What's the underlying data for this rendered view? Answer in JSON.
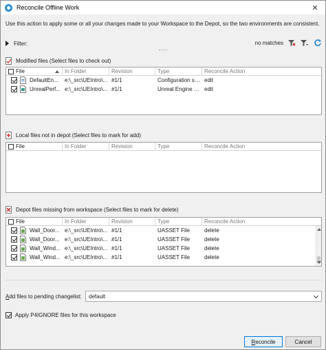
{
  "window": {
    "title": "Reconcile Offline Work",
    "close_glyph": "✕"
  },
  "intro_text": "Use this action to apply some or all your changes made to your Workspace to the Depot, so the two environments are consistent.",
  "filter": {
    "label": "Filter:",
    "status": "no matches"
  },
  "columns": {
    "file": "File",
    "folder": "In Folder",
    "revision": "Revision",
    "type": "Type",
    "action": "Reconcile Action"
  },
  "modified": {
    "title": "Modified files (Select files to check out)",
    "rows": [
      {
        "file": "DefaultEn...",
        "folder": "e:\\_src\\UEIntro\\...",
        "revision": "#1/1",
        "type": "Configuration set...",
        "action": "edit"
      },
      {
        "file": "UnrealPerf...",
        "folder": "e:\\_src\\UEIntro\\...",
        "revision": "#1/1",
        "type": "Unreal Engine Pr...",
        "action": "edit"
      }
    ]
  },
  "local": {
    "title": "Local files not in depot (Select files to mark for add)",
    "rows": []
  },
  "missing": {
    "title": "Depot files missing from workspace (Select files to mark for delete)",
    "rows": [
      {
        "file": "Wall_Door...",
        "folder": "e:\\_src\\UEIntro\\...",
        "revision": "#1/1",
        "type": "UASSET File",
        "action": "delete"
      },
      {
        "file": "Wall_Door...",
        "folder": "e:\\_src\\UEIntro\\...",
        "revision": "#1/1",
        "type": "UASSET File",
        "action": "delete"
      },
      {
        "file": "Wall_Wind...",
        "folder": "e:\\_src\\UEIntro\\...",
        "revision": "#1/1",
        "type": "UASSET File",
        "action": "delete"
      },
      {
        "file": "Wall_Wind...",
        "folder": "e:\\_src\\UEIntro\\...",
        "revision": "#1/1",
        "type": "UASSET File",
        "action": "delete"
      }
    ]
  },
  "changelist": {
    "label_accel": "A",
    "label_rest": "dd files to pending changelist:",
    "selected": "default"
  },
  "p4ignore": {
    "label": "Apply P4IGNORE files for this workspace",
    "checked": true
  },
  "buttons": {
    "reconcile_accel": "R",
    "reconcile_rest": "econcile",
    "cancel": "Cancel"
  },
  "colors": {
    "accent": "#0078d7",
    "checkbox_section_icon": "#d03030"
  }
}
